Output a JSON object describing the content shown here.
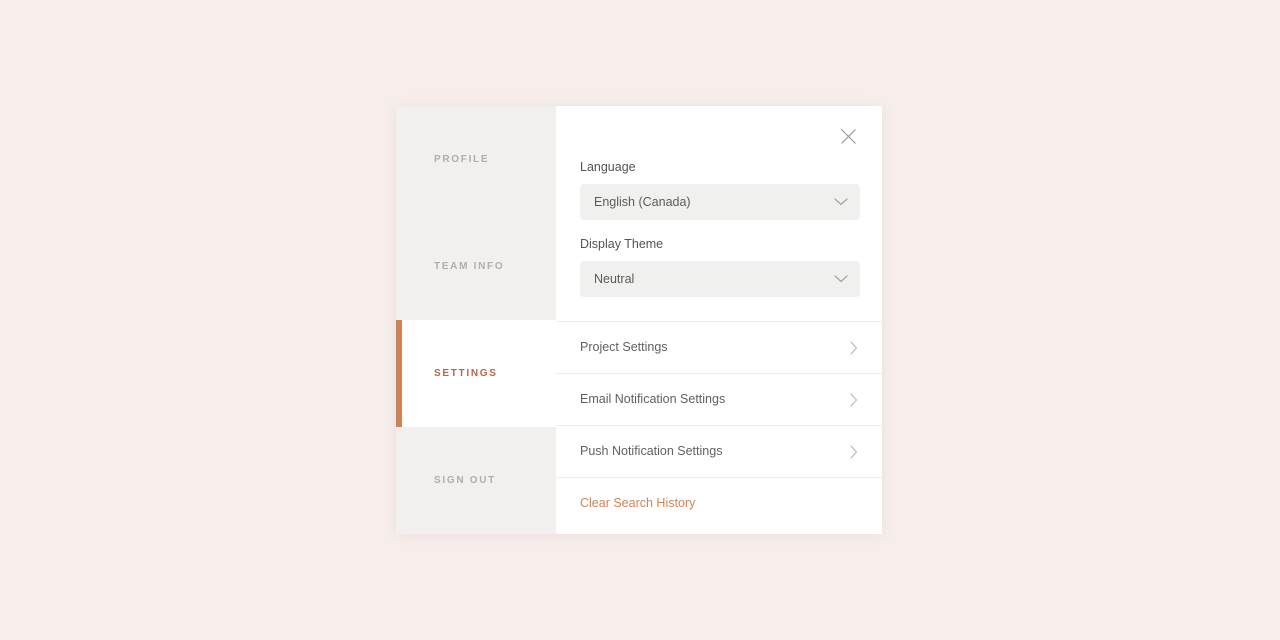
{
  "theme": {
    "page_background": "#f7eeec",
    "modal_background": "#ffffff",
    "sidebar_background": "#f1f0ef",
    "accent_color": "#cc8456",
    "active_label_color": "#b5654d",
    "muted_label_color": "#b0aeac",
    "field_background": "#f0f0ef",
    "divider_color": "#eeeceb"
  },
  "modal": {
    "close_icon": "close-icon",
    "close_label": "Close"
  },
  "sidebar": {
    "items": [
      {
        "label": "PROFILE",
        "active": false
      },
      {
        "label": "TEAM INFO",
        "active": false
      },
      {
        "label": "SETTINGS",
        "active": true
      },
      {
        "label": "SIGN OUT",
        "active": false
      }
    ]
  },
  "form": {
    "fields": [
      {
        "label": "Language",
        "value": "English (Canada)",
        "icon": "chevron-down-icon"
      },
      {
        "label": "Display Theme",
        "value": "Neutral",
        "icon": "chevron-down-icon"
      }
    ]
  },
  "rows": [
    {
      "label": "Project Settings",
      "icon": "chevron-right-icon",
      "accent": false
    },
    {
      "label": "Email Notification Settings",
      "icon": "chevron-right-icon",
      "accent": false
    },
    {
      "label": "Push Notification Settings",
      "icon": "chevron-right-icon",
      "accent": false
    },
    {
      "label": "Clear Search History",
      "icon": "",
      "accent": true
    }
  ]
}
